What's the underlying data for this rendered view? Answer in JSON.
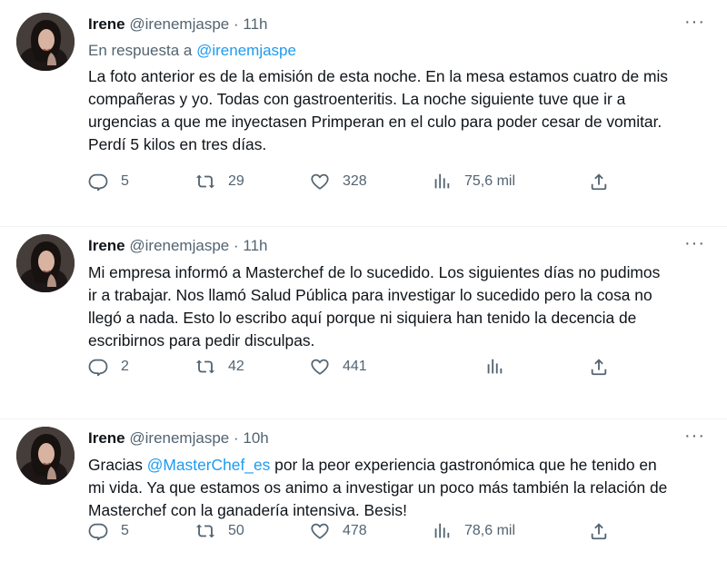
{
  "tweets": [
    {
      "name": "Irene",
      "handle": "@irenemjaspe",
      "separator": "·",
      "time": "11h",
      "reply_prefix": "En respuesta a",
      "reply_mention": "@irenemjaspe",
      "text": "La foto anterior es de la emisión de esta noche. En la mesa estamos cuatro de mis compañeras y yo. Todas con gastroenteritis. La noche siguiente tuve que ir a urgencias a que me inyectasen Primperan en el culo para poder cesar de vomitar. Perdí 5 kilos en tres días.",
      "more": "···",
      "replies": "5",
      "retweets": "29",
      "likes": "328",
      "views": "75,6 mil"
    },
    {
      "name": "Irene",
      "handle": "@irenemjaspe",
      "separator": "·",
      "time": "11h",
      "text": "Mi empresa informó a Masterchef de lo sucedido. Los siguientes días no pudimos ir a trabajar. Nos llamó Salud Pública para investigar lo sucedido pero la cosa no llegó a nada. Esto lo escribo aquí porque ni siquiera han tenido la decencia de escribirnos para pedir disculpas.",
      "more": "···",
      "replies": "2",
      "retweets": "42",
      "likes": "441",
      "views": ""
    },
    {
      "name": "Irene",
      "handle": "@irenemjaspe",
      "separator": "·",
      "time": "10h",
      "text_before": "Gracias ",
      "text_mention": "@MasterChef_es",
      "text_after": " por la peor experiencia gastronómica que he tenido en mi vida. Ya que estamos os animo a investigar un poco más también la relación de Masterchef con la ganadería intensiva. Besis!",
      "more": "···",
      "replies": "5",
      "retweets": "50",
      "likes": "478",
      "views": "78,6 mil"
    }
  ],
  "colors": {
    "text": "#0f1419",
    "secondary": "#536471",
    "link": "#1d9bf0",
    "border": "#eff3f4"
  },
  "icons": [
    "reply-icon",
    "retweet-icon",
    "like-icon",
    "views-icon",
    "share-icon",
    "more-icon"
  ]
}
